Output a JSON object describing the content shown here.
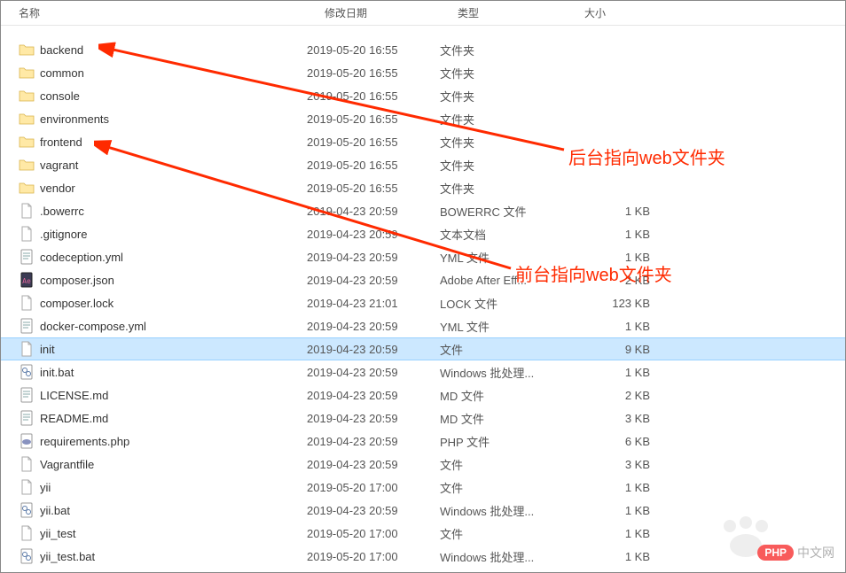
{
  "columns": {
    "name": "名称",
    "date": "修改日期",
    "type": "类型",
    "size": "大小"
  },
  "annotations": [
    "后台指向web文件夹",
    "前台指向web文件夹"
  ],
  "badge": {
    "php": "PHP",
    "cn": "中文网"
  },
  "rows": [
    {
      "icon": "folder",
      "name": "backend",
      "date": "2019-05-20 16:55",
      "type": "文件夹",
      "size": ""
    },
    {
      "icon": "folder",
      "name": "common",
      "date": "2019-05-20 16:55",
      "type": "文件夹",
      "size": ""
    },
    {
      "icon": "folder",
      "name": "console",
      "date": "2019-05-20 16:55",
      "type": "文件夹",
      "size": ""
    },
    {
      "icon": "folder",
      "name": "environments",
      "date": "2019-05-20 16:55",
      "type": "文件夹",
      "size": ""
    },
    {
      "icon": "folder",
      "name": "frontend",
      "date": "2019-05-20 16:55",
      "type": "文件夹",
      "size": ""
    },
    {
      "icon": "folder",
      "name": "vagrant",
      "date": "2019-05-20 16:55",
      "type": "文件夹",
      "size": ""
    },
    {
      "icon": "folder",
      "name": "vendor",
      "date": "2019-05-20 16:55",
      "type": "文件夹",
      "size": ""
    },
    {
      "icon": "file",
      "name": ".bowerrc",
      "date": "2019-04-23 20:59",
      "type": "BOWERRC 文件",
      "size": "1 KB"
    },
    {
      "icon": "file",
      "name": ".gitignore",
      "date": "2019-04-23 20:59",
      "type": "文本文档",
      "size": "1 KB"
    },
    {
      "icon": "yml",
      "name": "codeception.yml",
      "date": "2019-04-23 20:59",
      "type": "YML 文件",
      "size": "1 KB"
    },
    {
      "icon": "json",
      "name": "composer.json",
      "date": "2019-04-23 20:59",
      "type": "Adobe After Eff...",
      "size": "2 KB"
    },
    {
      "icon": "file",
      "name": "composer.lock",
      "date": "2019-04-23 21:01",
      "type": "LOCK 文件",
      "size": "123 KB"
    },
    {
      "icon": "yml",
      "name": "docker-compose.yml",
      "date": "2019-04-23 20:59",
      "type": "YML 文件",
      "size": "1 KB"
    },
    {
      "icon": "file",
      "name": "init",
      "date": "2019-04-23 20:59",
      "type": "文件",
      "size": "9 KB",
      "selected": true
    },
    {
      "icon": "bat",
      "name": "init.bat",
      "date": "2019-04-23 20:59",
      "type": "Windows 批处理...",
      "size": "1 KB"
    },
    {
      "icon": "md",
      "name": "LICENSE.md",
      "date": "2019-04-23 20:59",
      "type": "MD 文件",
      "size": "2 KB"
    },
    {
      "icon": "md",
      "name": "README.md",
      "date": "2019-04-23 20:59",
      "type": "MD 文件",
      "size": "3 KB"
    },
    {
      "icon": "php",
      "name": "requirements.php",
      "date": "2019-04-23 20:59",
      "type": "PHP 文件",
      "size": "6 KB"
    },
    {
      "icon": "file",
      "name": "Vagrantfile",
      "date": "2019-04-23 20:59",
      "type": "文件",
      "size": "3 KB"
    },
    {
      "icon": "file",
      "name": "yii",
      "date": "2019-05-20 17:00",
      "type": "文件",
      "size": "1 KB"
    },
    {
      "icon": "bat",
      "name": "yii.bat",
      "date": "2019-04-23 20:59",
      "type": "Windows 批处理...",
      "size": "1 KB"
    },
    {
      "icon": "file",
      "name": "yii_test",
      "date": "2019-05-20 17:00",
      "type": "文件",
      "size": "1 KB"
    },
    {
      "icon": "bat",
      "name": "yii_test.bat",
      "date": "2019-05-20 17:00",
      "type": "Windows 批处理...",
      "size": "1 KB"
    }
  ]
}
